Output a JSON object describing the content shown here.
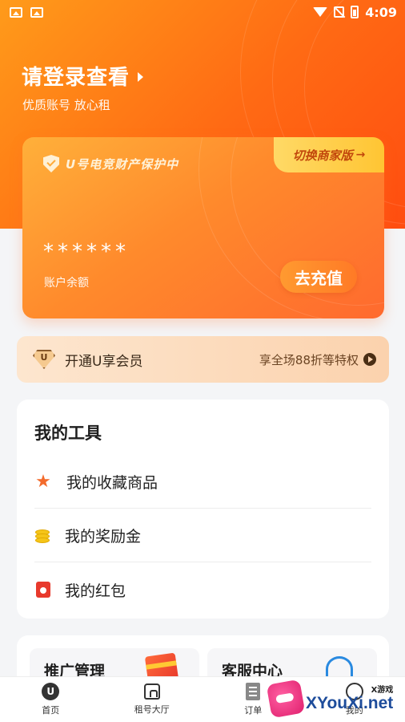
{
  "status_bar": {
    "time": "4:09"
  },
  "header": {
    "login_title": "请登录查看",
    "login_subtitle": "优质账号 放心租"
  },
  "balance_card": {
    "protect_label": "U号电竞财产保护中",
    "switch_label": "切换商家版",
    "switch_arrow": "→",
    "masked_amount": "******",
    "balance_label": "账户余额",
    "recharge_label": "去充值"
  },
  "vip": {
    "label": "开通U享会员",
    "icon_letter": "U",
    "promo": "享全场88折等特权"
  },
  "tools": {
    "title": "我的工具",
    "items": [
      {
        "label": "我的收藏商品",
        "icon": "star-icon"
      },
      {
        "label": "我的奖励金",
        "icon": "coins-icon"
      },
      {
        "label": "我的红包",
        "icon": "red-envelope-icon"
      }
    ]
  },
  "promo_cards": [
    {
      "label": "推广管理"
    },
    {
      "label": "客服中心"
    }
  ],
  "tabbar": {
    "items": [
      {
        "label": "首页",
        "icon_letter": "U"
      },
      {
        "label": "租号大厅"
      },
      {
        "label": "订单"
      },
      {
        "label": "我的"
      }
    ]
  },
  "watermark": {
    "small": "X游戏",
    "big": "XYouXi.net"
  },
  "colors": {
    "accent": "#ff6a14",
    "gold": "#ffc533",
    "tab_active": "#333333"
  }
}
